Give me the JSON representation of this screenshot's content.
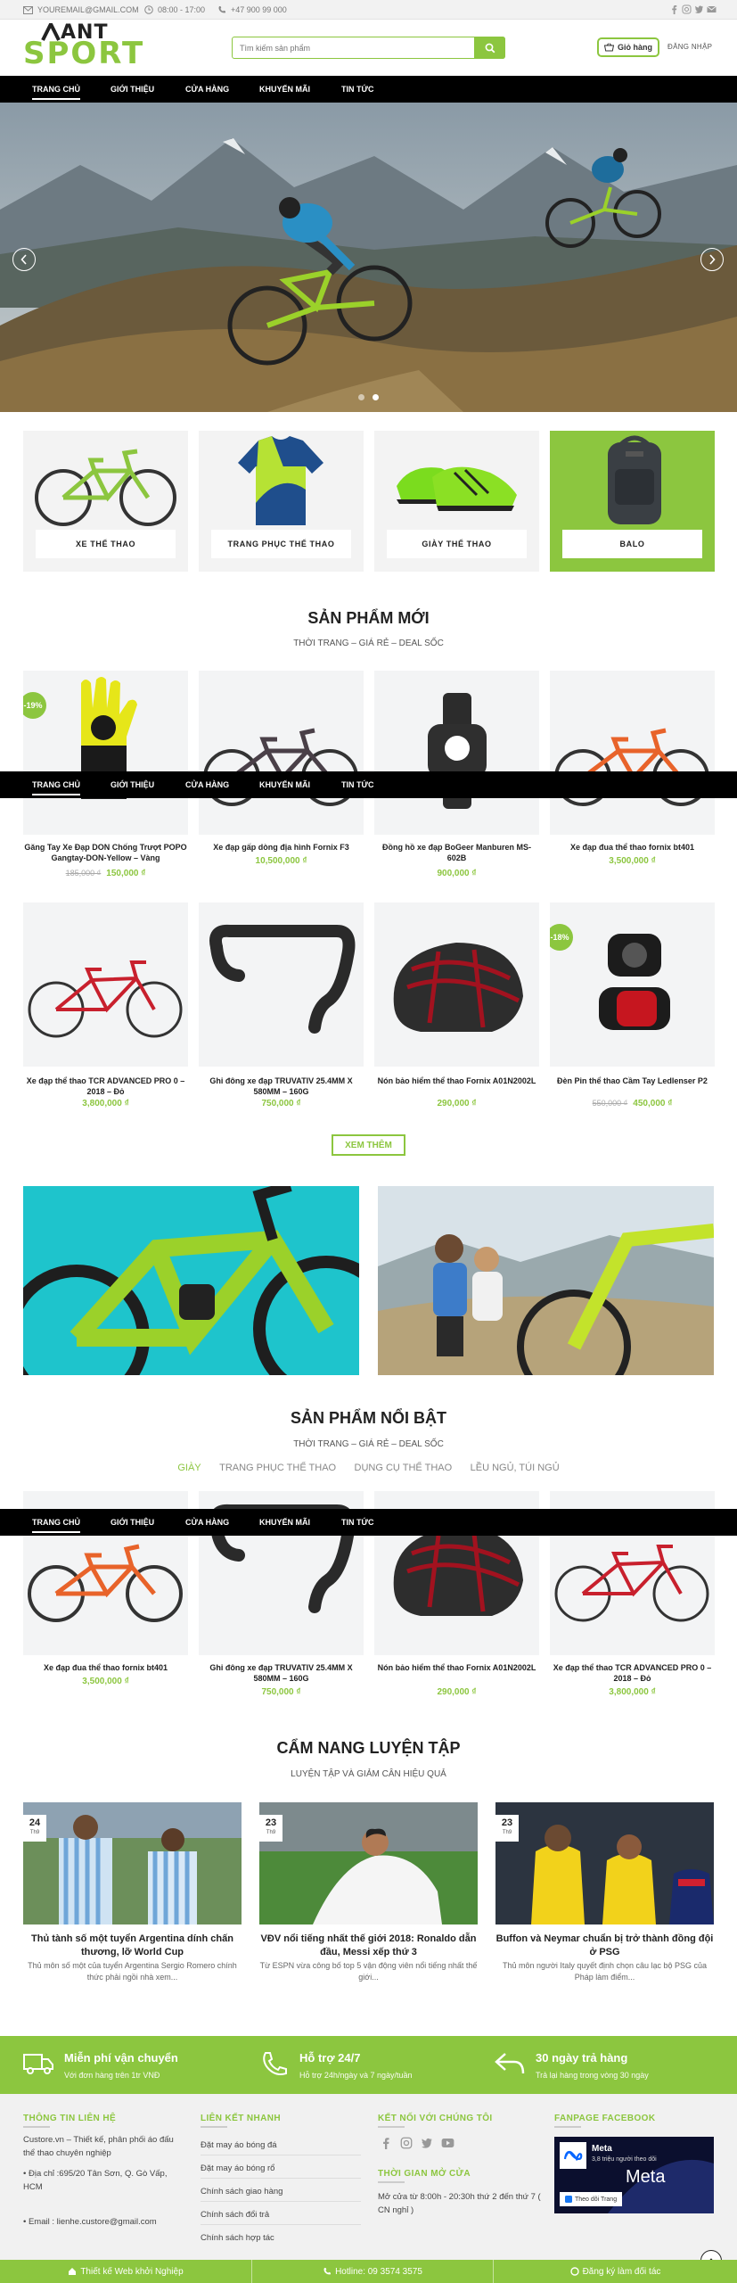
{
  "topbar": {
    "email": "YOUREMAIL@GMAIL.COM",
    "hours": "08:00 - 17:00",
    "phone": "+47 900 99 000"
  },
  "logo": {
    "line1": "ANT",
    "line2": "SPORT"
  },
  "search": {
    "placeholder": "Tìm kiếm sản phẩm"
  },
  "header": {
    "cart_label": "Giỏ hàng",
    "login_label": "ĐĂNG NHẬP"
  },
  "nav": {
    "items": [
      "TRANG CHỦ",
      "GIỚI THIỆU",
      "CỬA HÀNG",
      "KHUYẾN MÃI",
      "TIN TỨC"
    ]
  },
  "categories": [
    "XE THỂ THAO",
    "TRANG PHỤC THỂ THAO",
    "GIÀY THỂ THAO",
    "BALO"
  ],
  "new_products": {
    "title": "SẢN PHẨM MỚI",
    "subtitle": "THỜI TRANG – GIÁ RẺ – DEAL SỐC",
    "items": [
      {
        "name": "Găng Tay Xe Đạp DON Chống Trượt POPO Gangtay-DON-Yellow – Vàng",
        "old_price": "185,000 ₫",
        "price": "150,000 ₫",
        "badge": "-19%"
      },
      {
        "name": "Xe đạp gấp dòng địa hình Fornix F3",
        "price": "10,500,000 ₫"
      },
      {
        "name": "Đồng hồ xe đạp BoGeer Manburen MS-602B",
        "price": "900,000 ₫"
      },
      {
        "name": "Xe đạp đua thể thao fornix bt401",
        "price": "3,500,000 ₫"
      },
      {
        "name": "Xe đạp thể thao TCR ADVANCED PRO 0 – 2018 – Đỏ",
        "price": "3,800,000 ₫"
      },
      {
        "name": "Ghi đông xe đạp TRUVATIV 25.4MM X 580MM – 160G",
        "price": "750,000 ₫"
      },
      {
        "name": "Nón bảo hiểm thể thao Fornix A01N2002L",
        "price": "290,000 ₫"
      },
      {
        "name": "Đèn Pin thể thao Cầm Tay Ledlenser P2",
        "old_price": "550,000 ₫",
        "price": "450,000 ₫",
        "badge": "-18%"
      }
    ],
    "more_label": "XEM THÊM"
  },
  "featured": {
    "title": "SẢN PHẨM NỔI BẬT",
    "subtitle": "THỜI TRANG – GIÁ RẺ – DEAL SỐC",
    "tabs": [
      "GIÀY",
      "TRANG PHỤC THỂ THAO",
      "DỤNG CỤ THỂ THAO",
      "LỀU NGỦ, TÚI NGỦ"
    ],
    "items": [
      {
        "name": "Xe đạp đua thể thao fornix bt401",
        "price": "3,500,000 ₫"
      },
      {
        "name": "Ghi đông xe đạp TRUVATIV 25.4MM X 580MM – 160G",
        "price": "750,000 ₫"
      },
      {
        "name": "Nón bảo hiểm thể thao Fornix A01N2002L",
        "price": "290,000 ₫"
      },
      {
        "name": "Xe đạp thể thao TCR ADVANCED PRO 0 – 2018 – Đỏ",
        "price": "3,800,000 ₫"
      }
    ]
  },
  "blog": {
    "title": "CẨM NANG LUYỆN TẬP",
    "subtitle": "LUYỆN TẬP VÀ GIẢM CÂN HIỆU QUẢ",
    "posts": [
      {
        "day": "24",
        "month": "Th9",
        "title": "Thủ tành số một tuyển Argentina dính chấn thương, lỡ World Cup",
        "excerpt": "Thủ môn số một của tuyển Argentina Sergio Romero chính thức phải ngồi nhà xem..."
      },
      {
        "day": "23",
        "month": "Th9",
        "title": "VĐV nổi tiếng nhất thế giới 2018: Ronaldo dẫn đầu, Messi xếp thứ 3",
        "excerpt": "Từ ESPN vừa công bố top 5 vận động viên nổi tiếng nhất thế giới..."
      },
      {
        "day": "23",
        "month": "Th9",
        "title": "Buffon và Neymar chuẩn bị trở thành đồng đội ở PSG",
        "excerpt": "Thủ môn người Italy quyết định chọn câu lạc bộ PSG của Pháp làm điểm..."
      }
    ]
  },
  "services": [
    {
      "title": "Miễn phí vận chuyển",
      "sub": "Với đơn hàng trên 1tr VNĐ"
    },
    {
      "title": "Hỗ trợ 24/7",
      "sub": "Hỗ trợ 24h/ngày và 7 ngày/tuần"
    },
    {
      "title": "30 ngày trả hàng",
      "sub": "Trả lại hàng trong vòng 30 ngày"
    }
  ],
  "footer": {
    "contact_title": "THÔNG TIN LIÊN HỆ",
    "contact_desc": "Custore.vn – Thiết kế, phân phối áo đấu thể thao chuyên nghiệp",
    "address": "Địa chỉ :695/20 Tân Sơn, Q. Gò Vấp, HCM",
    "email": "Email : lienhe.custore@gmail.com",
    "links_title": "LIÊN KẾT NHANH",
    "links": [
      "Đặt may áo bóng đá",
      "Đặt may áo bóng rổ",
      "Chính sách giao hàng",
      "Chính sách đổi trả",
      "Chính sách hợp tác"
    ],
    "social_title": "KẾT NỐI VỚI CHÚNG TÔI",
    "hours_title": "THỜI GIAN MỞ CỬA",
    "hours_text": "Mở cửa từ 8:00h - 20:30h thứ 2 đến thứ 7 ( CN nghỉ )",
    "fb_title": "FANPAGE FACEBOOK",
    "fb_name": "Meta",
    "fb_followers": "3,8 triệu người theo dõi",
    "fb_big": "Meta",
    "fb_follow_btn": "Theo dõi Trang"
  },
  "bottom": {
    "item1": "Thiết kế Web khởi Nghiệp",
    "item2": "Hotline: 09 3574 3575",
    "item3": "Đăng ký làm đối tác"
  },
  "colors": {
    "accent": "#8cc63f",
    "nav": "#000000"
  }
}
